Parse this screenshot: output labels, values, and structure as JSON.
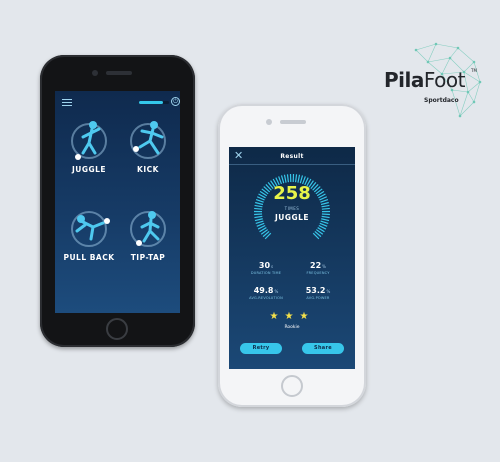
{
  "home_screen": {
    "modes": [
      {
        "label": "JUGGLE"
      },
      {
        "label": "KICK"
      },
      {
        "label": "PULL BACK"
      },
      {
        "label": "TIP-TAP"
      }
    ],
    "battery_level": 0.8
  },
  "result_screen": {
    "title": "Result",
    "count": "258",
    "count_unit": "TIMES",
    "mode": "JUGGLE",
    "stats": [
      {
        "value": "30",
        "unit": "s",
        "label": "DURATION TIME"
      },
      {
        "value": "22",
        "unit": "%",
        "label": "FREQUENCY"
      },
      {
        "value": "49.8",
        "unit": "%",
        "label": "AVG.REVOLUTION"
      },
      {
        "value": "53.2",
        "unit": "%",
        "label": "AVG.POWER"
      }
    ],
    "stars": "★★★",
    "rank": "Rookie",
    "retry_label": "Retry",
    "share_label": "Share"
  },
  "logo": {
    "brand_bold": "Pila",
    "brand_light": "Foot",
    "trademark": "TM",
    "sub": "Sportdaco"
  },
  "colors": {
    "accent": "#37c6ea",
    "count_yellow": "#e8f44a",
    "screen_navy": "#163b66",
    "background": "#e3e7ec"
  }
}
